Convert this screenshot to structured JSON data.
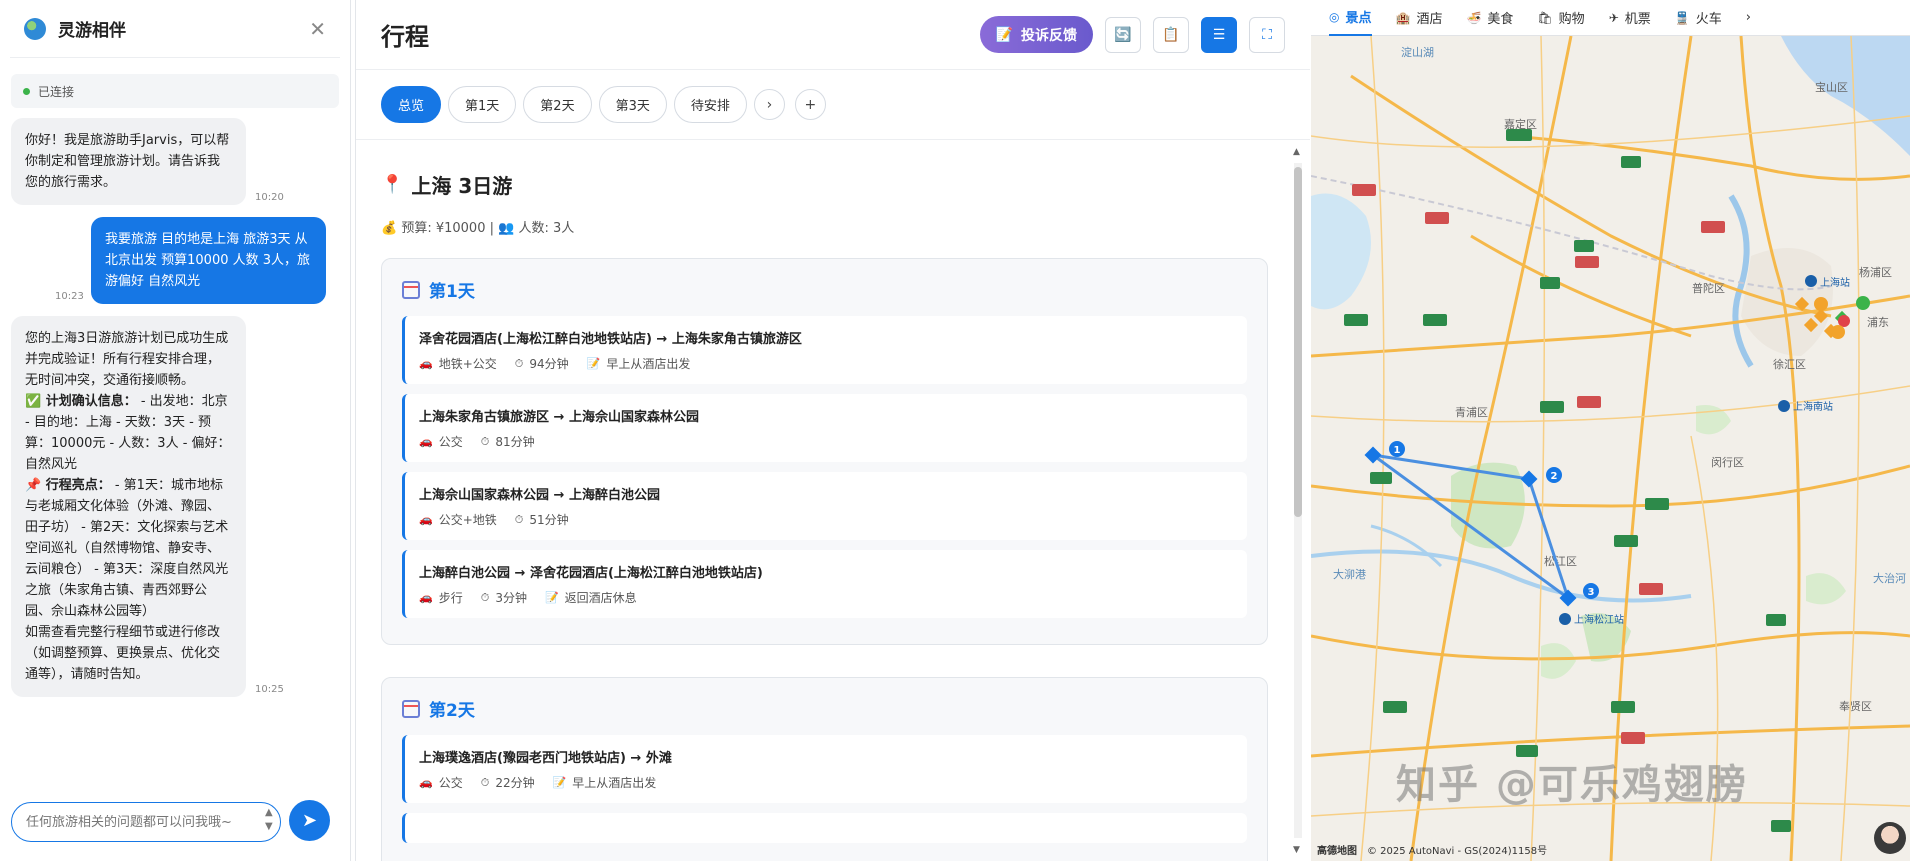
{
  "chat": {
    "title": "灵游相伴",
    "status": "已连接",
    "messages": [
      {
        "role": "bot",
        "time": "10:20",
        "text": "你好！我是旅游助手Jarvis，可以帮你制定和管理旅游计划。请告诉我您的旅行需求。"
      },
      {
        "role": "user",
        "time": "10:23",
        "text": "我要旅游 目的地是上海 旅游3天 从北京出发 预算10000 人数 3人，旅游偏好 自然风光"
      },
      {
        "role": "bot",
        "time": "10:25",
        "p1": "您的上海3日游旅游计划已成功生成并完成验证！所有行程安排合理，无时间冲突，交通衔接顺畅。",
        "p2_label": "✅ 计划确认信息：",
        "p2": " - 出发地：北京 - 目的地：上海 - 天数：3天 - 预算：10000元 - 人数：3人 - 偏好：自然风光",
        "p3_label": "📌 行程亮点：",
        "p3": " - 第1天：城市地标与老城厢文化体验（外滩、豫园、田子坊） - 第2天：文化探索与艺术空间巡礼（自然博物馆、静安寺、云间粮仓） - 第3天：深度自然风光之旅（朱家角古镇、青西郊野公园、佘山森林公园等）",
        "p4": "如需查看完整行程细节或进行修改（如调整预算、更换景点、优化交通等），请随时告知。"
      }
    ],
    "input_placeholder": "任何旅游相关的问题都可以问我哦~"
  },
  "plan": {
    "title": "行程",
    "complaint_label": "投诉反馈",
    "tabs": [
      "总览",
      "第1天",
      "第2天",
      "第3天",
      "待安排"
    ],
    "trip_title": "上海 3日游",
    "budget": "预算: ¥10000 |",
    "people": "人数: 3人",
    "days": [
      {
        "title": "第1天",
        "segments": [
          {
            "route": "泽舍花园酒店(上海松江醉白池地铁站店) → 上海朱家角古镇旅游区",
            "transport": "地铁+公交",
            "duration": "94分钟",
            "note": "早上从酒店出发"
          },
          {
            "route": "上海朱家角古镇旅游区 → 上海佘山国家森林公园",
            "transport": "公交",
            "duration": "81分钟"
          },
          {
            "route": "上海佘山国家森林公园 → 上海醉白池公园",
            "transport": "公交+地铁",
            "duration": "51分钟"
          },
          {
            "route": "上海醉白池公园 → 泽舍花园酒店(上海松江醉白池地铁站店)",
            "transport": "步行",
            "duration": "3分钟",
            "note": "返回酒店休息"
          }
        ]
      },
      {
        "title": "第2天",
        "segments": [
          {
            "route": "上海璞逸酒店(豫园老西门地铁站店) → 外滩",
            "transport": "公交",
            "duration": "22分钟",
            "note": "早上从酒店出发"
          }
        ]
      }
    ]
  },
  "map": {
    "tabs": [
      "景点",
      "酒店",
      "美食",
      "购物",
      "机票",
      "火车"
    ],
    "districts": [
      "嘉定区",
      "宝山区",
      "普陀区",
      "杨浦区",
      "徐汇区",
      "浦东",
      "青浦区",
      "闵行区",
      "松江区",
      "奉贤区",
      "淀山湖",
      "大泖港",
      "大治河"
    ],
    "stations": [
      "上海站",
      "上海南站",
      "上海松江站"
    ],
    "route_stops": [
      "1",
      "2",
      "3"
    ],
    "watermark": "知乎 @可乐鸡翅膀",
    "attribution_logo": "高德地图",
    "attribution": "© 2025 AutoNavi - GS(2024)1158号",
    "route_color": "#4a8fe0"
  }
}
